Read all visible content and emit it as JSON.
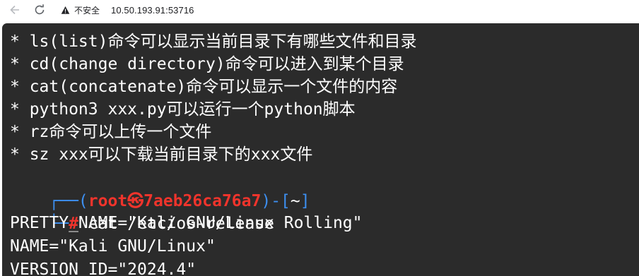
{
  "browser": {
    "warning_label": "不安全",
    "url": "10.50.193.91:53716"
  },
  "terminal": {
    "info_lines": [
      "* ls(list)命令可以显示当前目录下有哪些文件和目录",
      "* cd(change directory)命令可以进入到某个目录",
      "* cat(concatenate)命令可以显示一个文件的内容",
      "* python3 xxx.py可以运行一个python脚本",
      "* rz命令可以上传一个文件",
      "* sz xxx可以下载当前目录下的xxx文件"
    ],
    "prompt": {
      "frame_open": "┌──(",
      "user_host": "root㉿7aeb26ca76a7",
      "frame_mid": ")-[",
      "cwd": "~",
      "frame_close": "]",
      "frame_lower": "└─",
      "symbol": "#",
      "command": " cat /etc/os-release"
    },
    "output_lines": [
      "PRETTY_NAME=\"Kali GNU/Linux Rolling\"",
      "NAME=\"Kali GNU/Linux\"",
      "VERSION_ID=\"2024.4\""
    ]
  }
}
